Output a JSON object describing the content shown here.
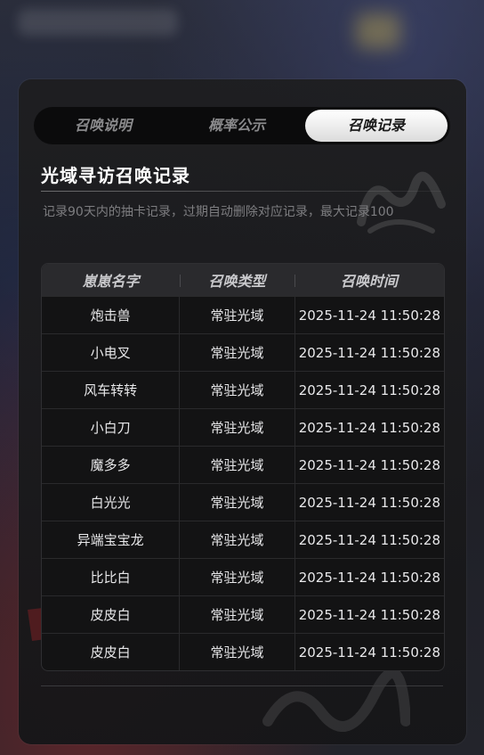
{
  "tabs": [
    {
      "label": "召唤说明",
      "active": false
    },
    {
      "label": "概率公示",
      "active": false
    },
    {
      "label": "召唤记录",
      "active": true
    }
  ],
  "section": {
    "title": "光域寻访召唤记录",
    "subtitle": "记录90天内的抽卡记录，过期自动删除对应记录，最大记录100"
  },
  "table": {
    "headers": [
      "崽崽名字",
      "召唤类型",
      "召唤时间"
    ],
    "rows": [
      [
        "炮击兽",
        "常驻光域",
        "2025-11-24 11:50:28"
      ],
      [
        "小电叉",
        "常驻光域",
        "2025-11-24 11:50:28"
      ],
      [
        "风车转转",
        "常驻光域",
        "2025-11-24 11:50:28"
      ],
      [
        "小白刀",
        "常驻光域",
        "2025-11-24 11:50:28"
      ],
      [
        "魔多多",
        "常驻光域",
        "2025-11-24 11:50:28"
      ],
      [
        "白光光",
        "常驻光域",
        "2025-11-24 11:50:28"
      ],
      [
        "异端宝宝龙",
        "常驻光域",
        "2025-11-24 11:50:28"
      ],
      [
        "比比白",
        "常驻光域",
        "2025-11-24 11:50:28"
      ],
      [
        "皮皮白",
        "常驻光域",
        "2025-11-24 11:50:28"
      ],
      [
        "皮皮白",
        "常驻光域",
        "2025-11-24 11:50:28"
      ]
    ]
  },
  "colors": {
    "panel_bg": "#1e1e20",
    "active_tab_bg": "#ffffff",
    "inactive_tab_text": "#8a8a8c",
    "header_bg": "#2a2a2d"
  }
}
